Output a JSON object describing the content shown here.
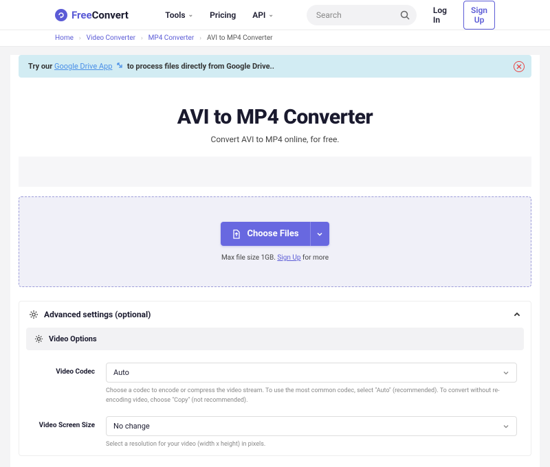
{
  "header": {
    "logo_free": "Free",
    "logo_convert": "Convert",
    "nav": {
      "tools": "Tools",
      "pricing": "Pricing",
      "api": "API"
    },
    "search_placeholder": "Search",
    "login": "Log In",
    "signup": "Sign Up"
  },
  "breadcrumbs": {
    "home": "Home",
    "video": "Video Converter",
    "mp4": "MP4 Converter",
    "current": "AVI to MP4 Converter"
  },
  "banner": {
    "prefix": "Try our ",
    "link": "Google Drive App",
    "suffix": " to process files directly from Google Drive.."
  },
  "hero": {
    "title": "AVI to MP4 Converter",
    "subtitle": "Convert AVI to MP4 online, for free."
  },
  "drop": {
    "choose": "Choose Files",
    "max_prefix": "Max file size 1GB. ",
    "max_link": "Sign Up",
    "max_suffix": " for more"
  },
  "advanced": {
    "title": "Advanced settings (optional)",
    "video_options": "Video Options",
    "codec": {
      "label": "Video Codec",
      "value": "Auto",
      "desc": "Choose a codec to encode or compress the video stream. To use the most common codec, select \"Auto\" (recommended). To convert without re-encoding video, choose \"Copy\" (not recommended)."
    },
    "size": {
      "label": "Video Screen Size",
      "value": "No change",
      "desc": "Select a resolution for your video (width x height) in pixels."
    }
  }
}
